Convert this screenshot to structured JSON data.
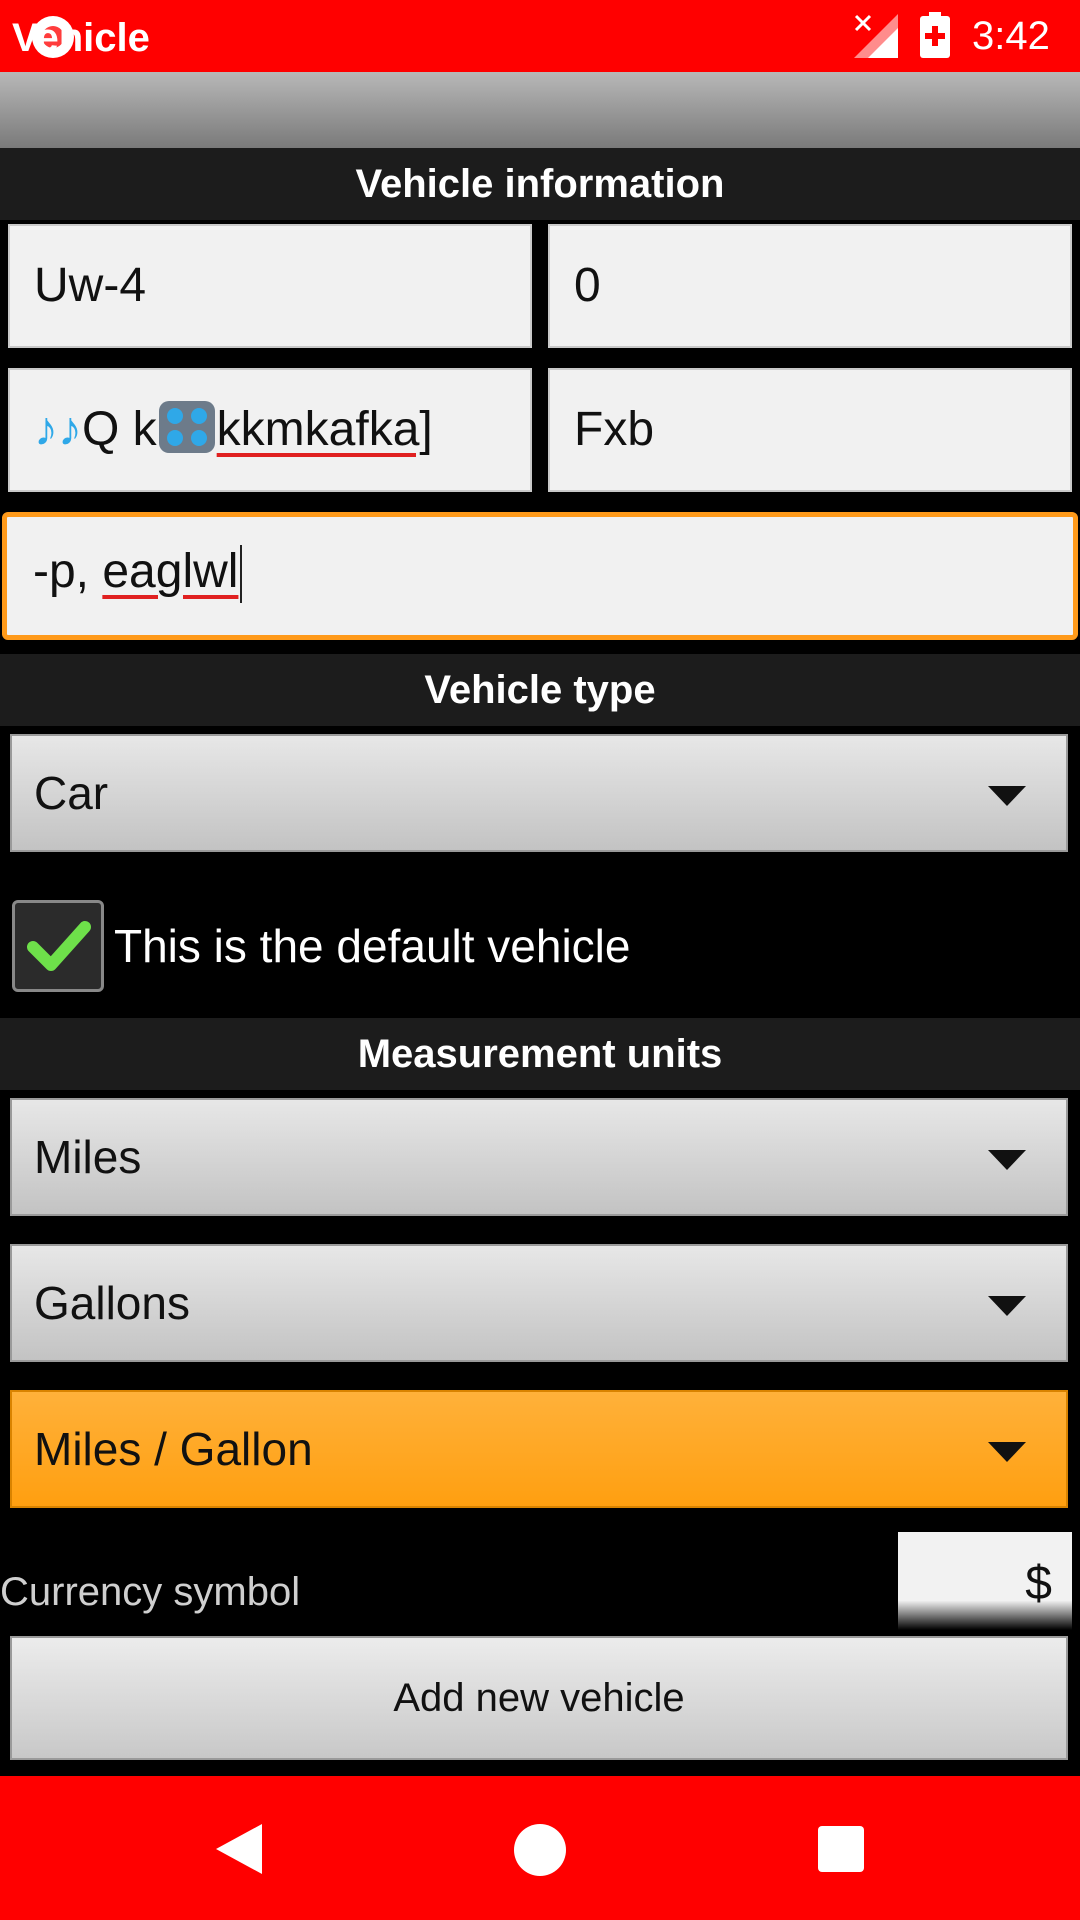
{
  "status_bar": {
    "time": "3:42",
    "icons": [
      "screen-record-icon",
      "no-signal-icon",
      "battery-charging-icon"
    ]
  },
  "title_bar": {
    "title": "Vehicle"
  },
  "vehicle_info": {
    "header": "Vehicle information",
    "field_1": "Uw-4",
    "field_2": "0",
    "field_3_prefix": "Q k",
    "field_3_suffix": "kkmkafka]",
    "field_4": "Fxb",
    "field_5_prefix": "-p, ",
    "field_5_suffix": "eaglwl"
  },
  "vehicle_type": {
    "header": "Vehicle type",
    "selected": "Car"
  },
  "default_checkbox": {
    "label": "This is the default vehicle",
    "checked": true
  },
  "measurement_units": {
    "header": "Measurement units",
    "distance": "Miles",
    "volume": "Gallons",
    "economy": "Miles / Gallon"
  },
  "currency": {
    "label": "Currency symbol",
    "value": "$"
  },
  "add_button": {
    "label": "Add new vehicle"
  },
  "colors": {
    "status_bar": "#ff0000",
    "nav_bar": "#ff0000",
    "accent": "#ff9a1a",
    "checkmark": "#6ee04a"
  }
}
